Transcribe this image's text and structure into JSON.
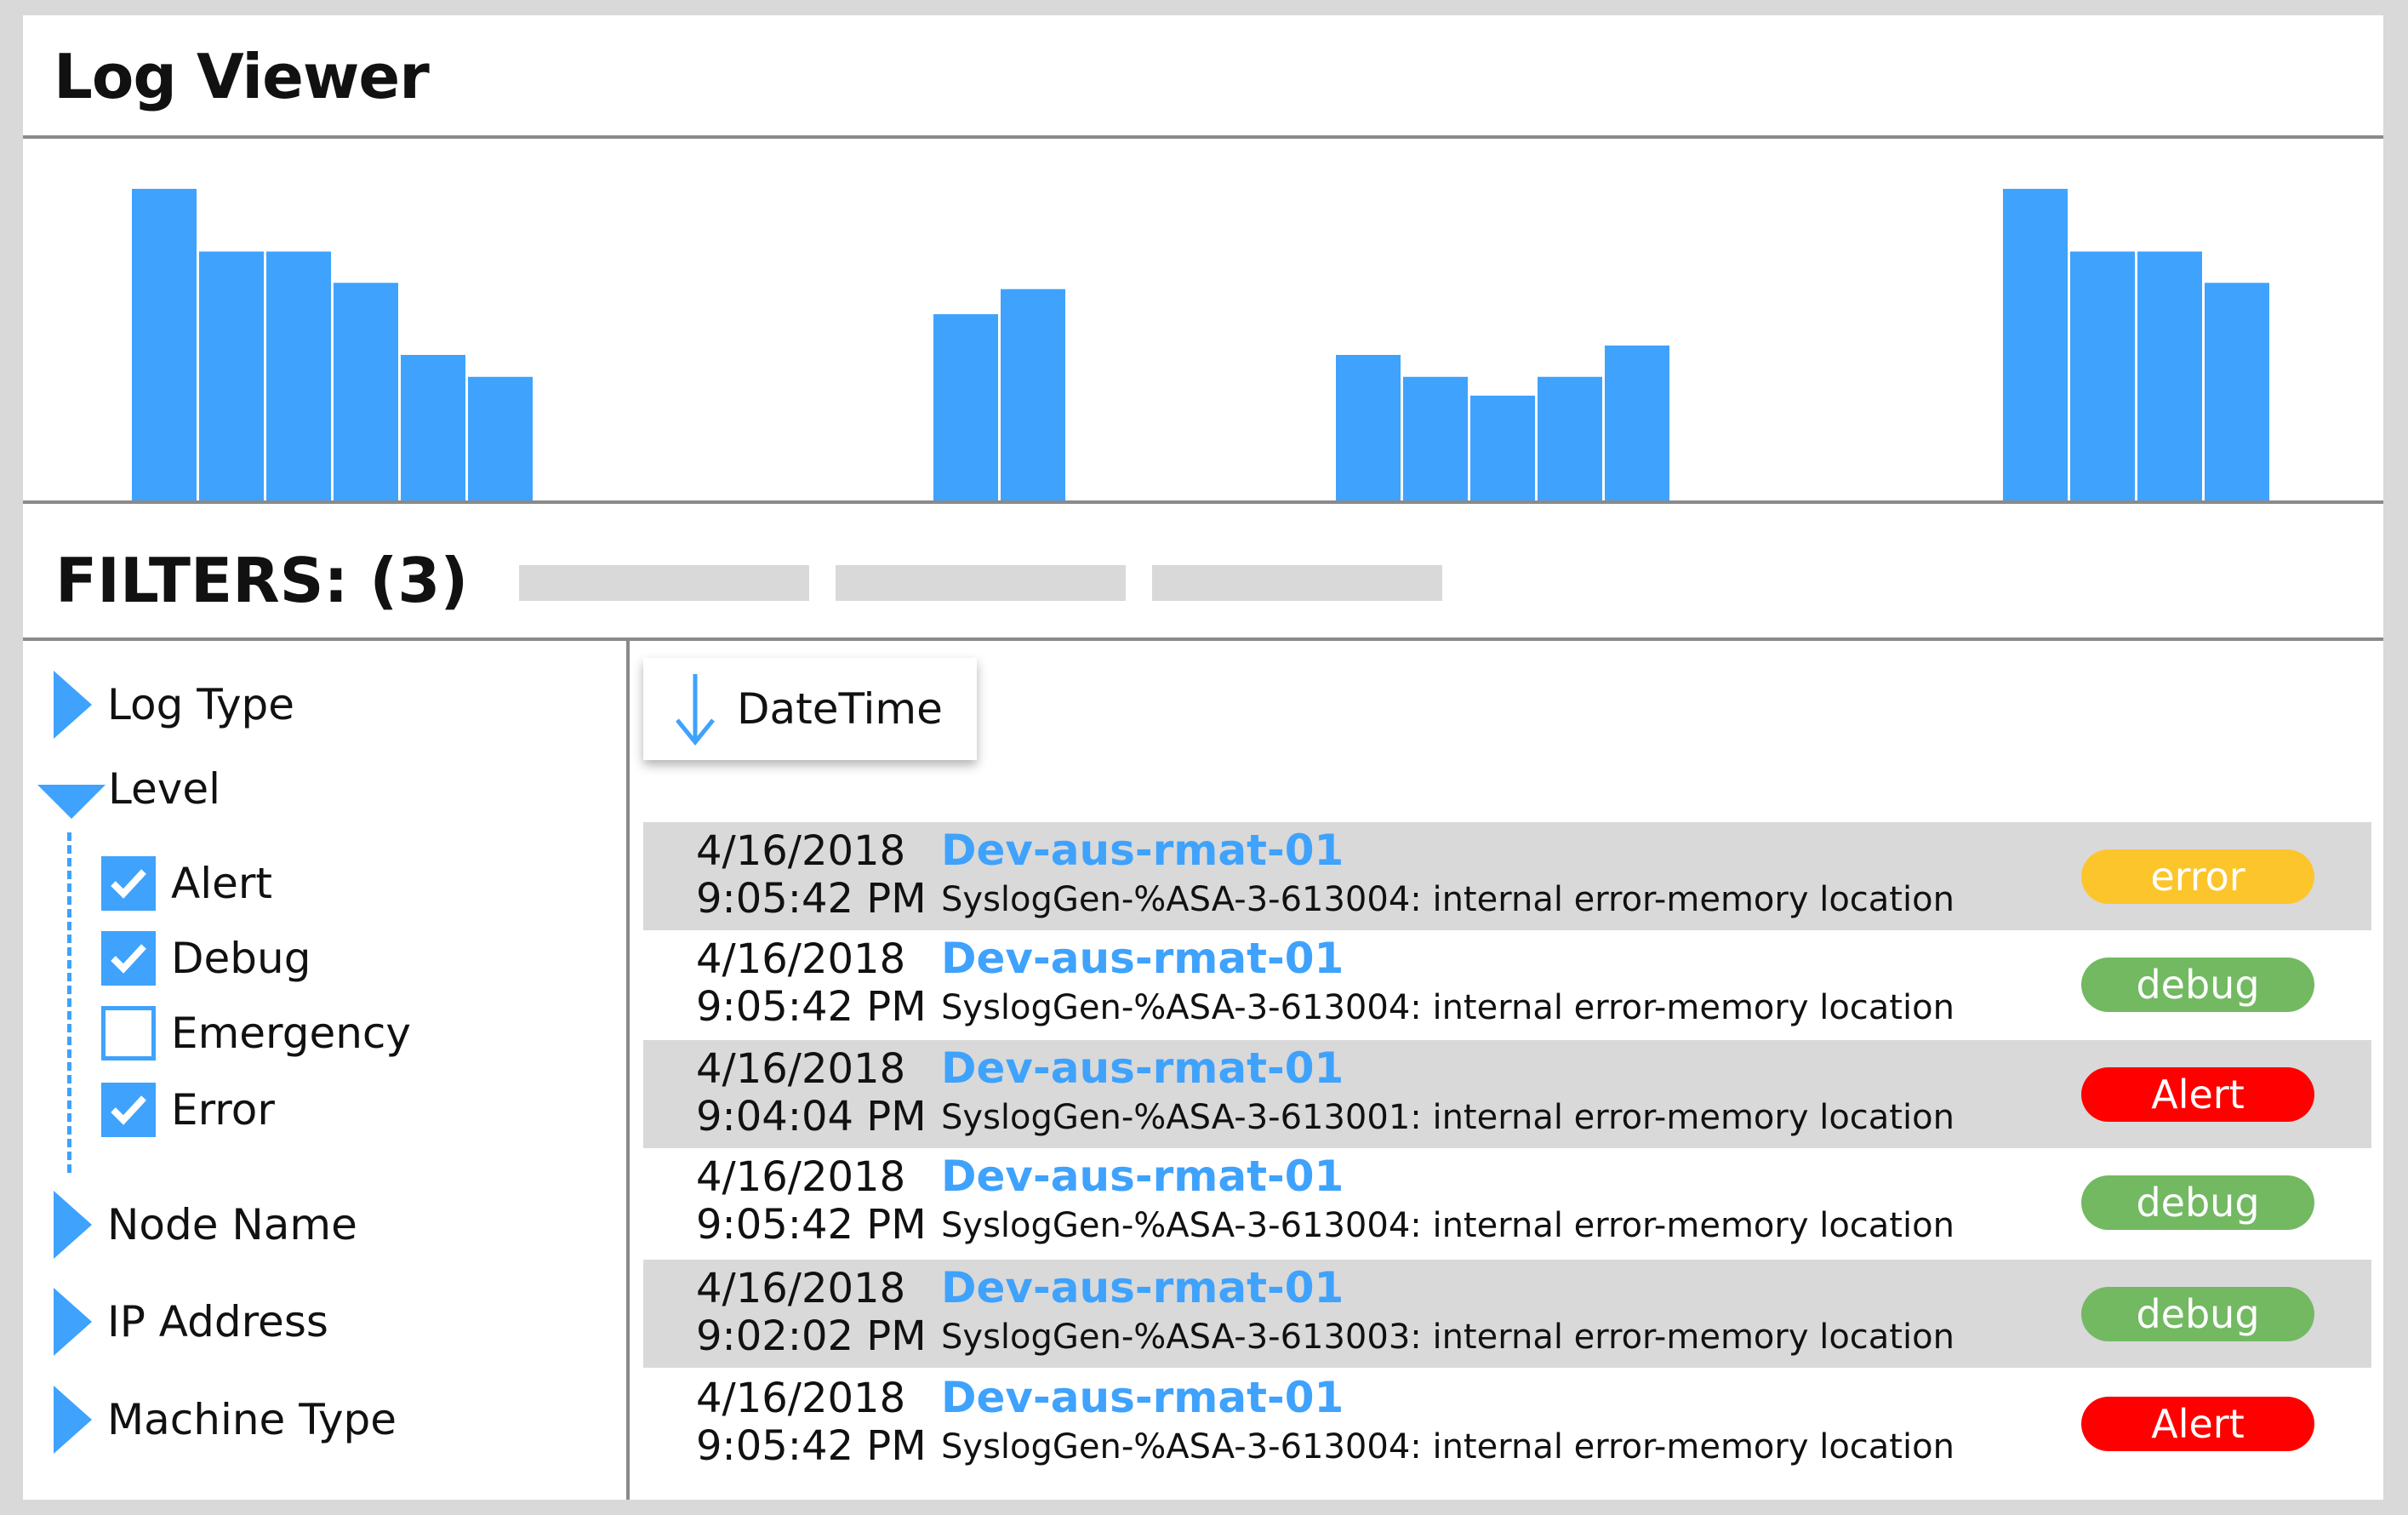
{
  "header": {
    "title": "Log Viewer"
  },
  "chart_data": {
    "type": "bar",
    "title": "",
    "xlabel": "",
    "ylabel": "",
    "grid": false,
    "ylim": [
      0,
      116
    ],
    "groups": [
      {
        "values": [
          100,
          80,
          80,
          70,
          47,
          40
        ]
      },
      {
        "values": [
          60,
          68
        ]
      },
      {
        "values": [
          47,
          40,
          34,
          40,
          50
        ]
      },
      {
        "values": [
          100,
          80,
          80,
          70
        ]
      }
    ],
    "color": "#3fa2fd"
  },
  "filters": {
    "title": "FILTERS: (3)",
    "chips": [
      "",
      "",
      ""
    ]
  },
  "sidebar": {
    "items": [
      {
        "label": "Log Type",
        "expanded": false
      },
      {
        "label": "Level",
        "expanded": true,
        "options": [
          {
            "label": "Alert",
            "checked": true
          },
          {
            "label": "Debug",
            "checked": true
          },
          {
            "label": "Emergency",
            "checked": false
          },
          {
            "label": "Error",
            "checked": true
          }
        ]
      },
      {
        "label": "Node Name",
        "expanded": false
      },
      {
        "label": "IP Address",
        "expanded": false
      },
      {
        "label": "Machine Type",
        "expanded": false
      }
    ]
  },
  "sort": {
    "label": "DateTime",
    "icon": "arrow-down-icon"
  },
  "logs": [
    {
      "date": "4/16/2018",
      "time": "9:05:42 PM",
      "host": "Dev-aus-rmat-01",
      "message": "SyslogGen-%ASA-3-613004: internal error-memory location",
      "level": "error",
      "color": "#fcc52c"
    },
    {
      "date": "4/16/2018",
      "time": "9:05:42 PM",
      "host": "Dev-aus-rmat-01",
      "message": "SyslogGen-%ASA-3-613004: internal error-memory location",
      "level": "debug",
      "color": "#72b962"
    },
    {
      "date": "4/16/2018",
      "time": "9:04:04 PM",
      "host": "Dev-aus-rmat-01",
      "message": "SyslogGen-%ASA-3-613001: internal error-memory location",
      "level": "Alert",
      "color": "#ff0000"
    },
    {
      "date": "4/16/2018",
      "time": "9:05:42 PM",
      "host": "Dev-aus-rmat-01",
      "message": "SyslogGen-%ASA-3-613004: internal error-memory location",
      "level": "debug",
      "color": "#72b962"
    },
    {
      "date": "4/16/2018",
      "time": "9:02:02 PM",
      "host": "Dev-aus-rmat-01",
      "message": "SyslogGen-%ASA-3-613003: internal error-memory location",
      "level": "debug",
      "color": "#72b962"
    },
    {
      "date": "4/16/2018",
      "time": "9:05:42 PM",
      "host": "Dev-aus-rmat-01",
      "message": "SyslogGen-%ASA-3-613004: internal error-memory location",
      "level": "Alert",
      "color": "#ff0000"
    }
  ]
}
